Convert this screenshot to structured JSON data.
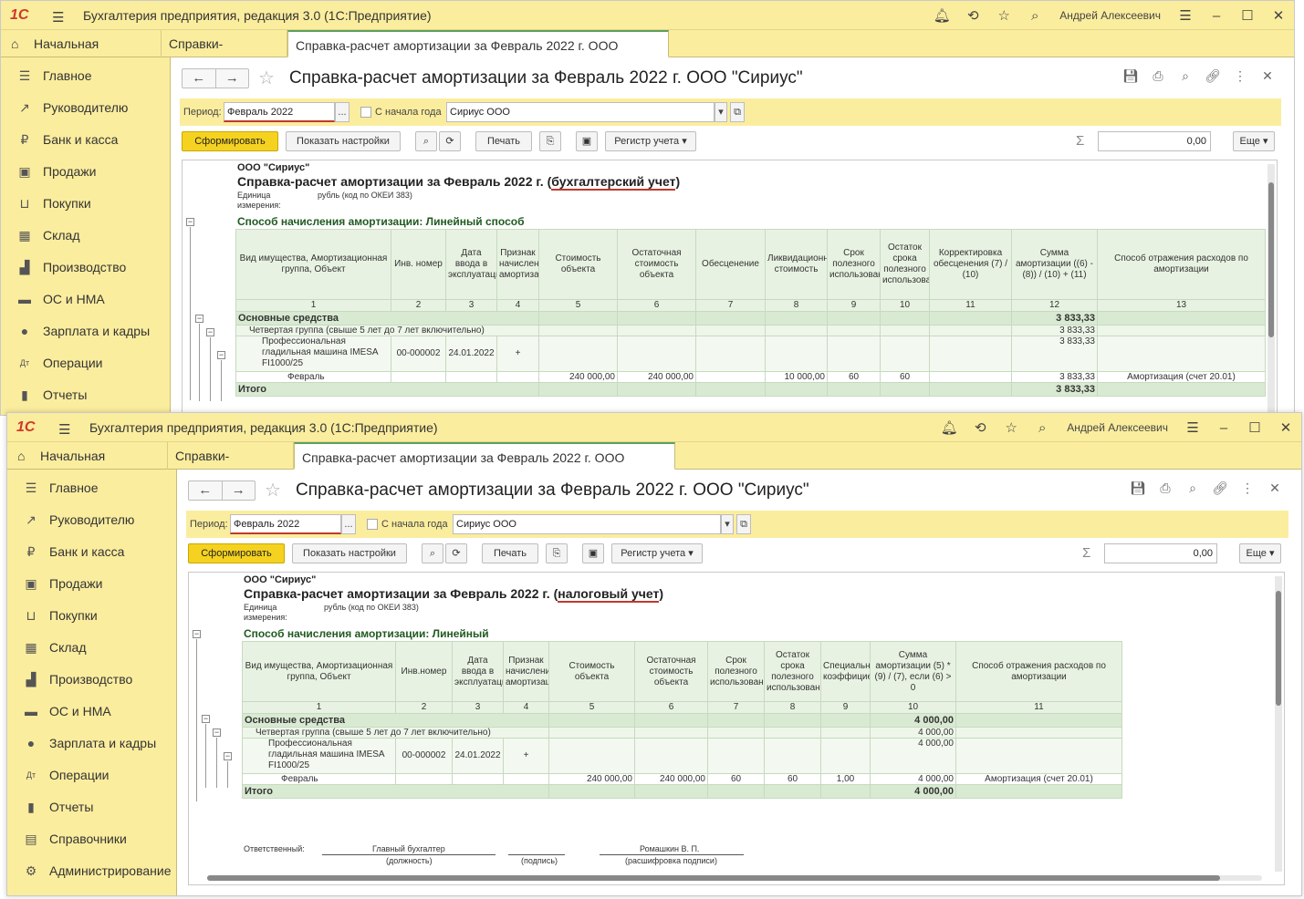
{
  "app_title": "Бухгалтерия предприятия, редакция 3.0  (1С:Предприятие)",
  "logo_text": "1С",
  "user": "Андрей Алексеевич",
  "tabs": {
    "home": "Начальная страница",
    "refs": "Справки-расчеты",
    "active": "Справка-расчет амортизации за Февраль 2022 г. ООО \"Сириус\""
  },
  "sidebar": [
    "Главное",
    "Руководителю",
    "Банк и касса",
    "Продажи",
    "Покупки",
    "Склад",
    "Производство",
    "ОС и НМА",
    "Зарплата и кадры",
    "Операции",
    "Отчеты",
    "Справочники",
    "Администрирование"
  ],
  "doc_title": "Справка-расчет амортизации за Февраль 2022 г. ООО \"Сириус\"",
  "form": {
    "period_label": "Период:",
    "period_value": "Февраль 2022",
    "from_year_label": "С начала года",
    "org_value": "Сириус ООО",
    "generate": "Сформировать",
    "show_settings": "Показать настройки",
    "print": "Печать",
    "register": "Регистр учета",
    "sum_value": "0,00",
    "more": "Еще"
  },
  "report1": {
    "org": "ООО \"Сириус\"",
    "title_prefix": "Справка-расчет амортизации за Февраль 2022 г. (",
    "title_hl": "бухгалтерский учет",
    "title_suffix": ")",
    "units_label_1": "Единица",
    "units_label_2": "измерения:",
    "units_value": "рубль (код по ОКЕИ 383)",
    "method": "Способ начисления амортизации:  Линейный способ",
    "headers": [
      "Вид имущества, Амортизационная группа, Объект",
      "Инв. номер",
      "Дата ввода в эксплуатацию",
      "Признак начисления амортизации",
      "Стоимость объекта",
      "Остаточная стоимость объекта",
      "Обесценение",
      "Ликвидационная стоимость",
      "Срок полезного использования",
      "Остаток срока полезного использования",
      "Корректировка обесценения (7) / (10)",
      "Сумма амортизации ((6) - (8)) / (10) + (11)",
      "Способ отражения расходов по амортизации"
    ],
    "nums": [
      "1",
      "2",
      "3",
      "4",
      "5",
      "6",
      "7",
      "8",
      "9",
      "10",
      "11",
      "12",
      "13"
    ],
    "group": "Основные средства",
    "group_sum": "3 833,33",
    "subgroup": "Четвертая группа (свыше 5 лет до 7 лет включительно)",
    "subgroup_sum": "3 833,33",
    "item": "Профессиональная гладильная машина IMESA FI1000/25",
    "item_inv": "00-000002",
    "item_date": "24.01.2022",
    "item_flag": "+",
    "item_sum": "3 833,33",
    "month": "Февраль",
    "m_cost": "240 000,00",
    "m_residual": "240 000,00",
    "m_liquid": "10 000,00",
    "m_term": "60",
    "m_rest": "60",
    "m_sum": "3 833,33",
    "m_method": "Амортизация (счет 20.01)",
    "total": "Итого",
    "total_sum": "3 833,33"
  },
  "report2": {
    "org": "ООО \"Сириус\"",
    "title_prefix": "Справка-расчет амортизации за Февраль 2022 г. (",
    "title_hl": "налоговый учет",
    "title_suffix": ")",
    "units_label_1": "Единица",
    "units_label_2": "измерения:",
    "units_value": "рубль (код по ОКЕИ 383)",
    "method": "Способ начисления амортизации:  Линейный",
    "headers": [
      "Вид имущества, Амортизационная группа, Объект",
      "Инв.номер",
      "Дата ввода в эксплуатацию",
      "Признак начисления амортизации",
      "Стоимость объекта",
      "Остаточная стоимость объекта",
      "Срок полезного использования",
      "Остаток срока полезного использования",
      "Специальный коэффициент",
      "Сумма амортизации (5) * (9) / (7), если (6) > 0",
      "Способ отражения расходов по амортизации"
    ],
    "nums": [
      "1",
      "2",
      "3",
      "4",
      "5",
      "6",
      "7",
      "8",
      "9",
      "10",
      "11"
    ],
    "group": "Основные средства",
    "group_sum": "4 000,00",
    "subgroup": "Четвертая группа (свыше 5 лет до 7 лет включительно)",
    "subgroup_sum": "4 000,00",
    "item": "Профессиональная гладильная машина IMESA FI1000/25",
    "item_inv": "00-000002",
    "item_date": "24.01.2022",
    "item_flag": "+",
    "item_sum": "4 000,00",
    "month": "Февраль",
    "m_cost": "240 000,00",
    "m_residual": "240 000,00",
    "m_term": "60",
    "m_rest": "60",
    "m_coef": "1,00",
    "m_sum": "4 000,00",
    "m_method": "Амортизация (счет 20.01)",
    "total": "Итого",
    "total_sum": "4 000,00",
    "sign_resp": "Ответственный:",
    "sign_pos": "Главный бухгалтер",
    "sign_pos_cap": "(должность)",
    "sign_sig_cap": "(подпись)",
    "sign_name": "Ромашкин В. П.",
    "sign_name_cap": "(расшифровка подписи)"
  }
}
